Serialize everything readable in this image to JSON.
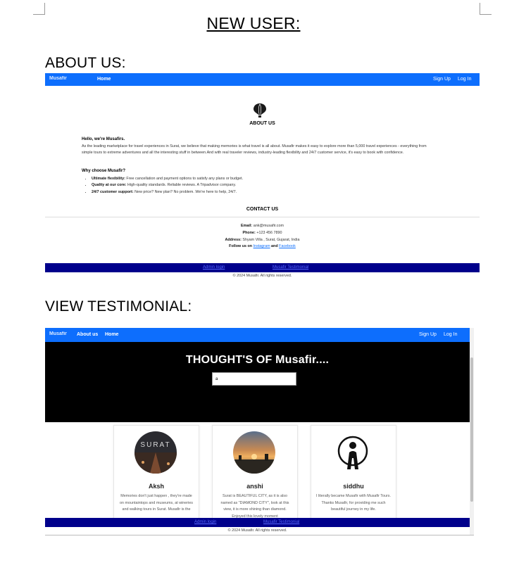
{
  "document": {
    "title": "NEW USER:",
    "sections": {
      "about_heading": "ABOUT US:",
      "testimonial_heading": "VIEW TESTIMONIAL:"
    }
  },
  "about_page": {
    "navbar": {
      "brand": "Musafir",
      "home": "Home",
      "sign_up": "Sign Up",
      "log_in": "Log In"
    },
    "logo_icon": "hot-air-balloon-icon",
    "about_title": "ABOUT US",
    "intro_heading": "Hello, we're Musafirs.",
    "intro_text": "As the leading marketplace for travel experiences in Surat, we believe that making memories is what travel is all about. Musafir makes it easy to explore more than 5,000 travel experiences - everything from simple tours to extreme adventures and all the interesting stuff in between.And with real traveler reviews, industry-leading flexibility and 24/7 customer service, it's easy to book with confidence.",
    "why_heading": "Why choose Musafir?",
    "why_items": [
      {
        "label": "Ultimate flexibility:",
        "text": " Free cancellation and payment options to satisfy any plans or budget."
      },
      {
        "label": "Quality at our core:",
        "text": " High-quality standards. Reliable reviews. A Tripadvisor company."
      },
      {
        "label": "24/7 customer support:",
        "text": " New price? New plan? No problem. We're here to help, 24/7."
      }
    ],
    "contact_title": "CONTACT US",
    "contact": {
      "email_label": "Email:",
      "email": " ank@musafir.com",
      "phone_label": "Phone:",
      "phone": " +123 456 7890",
      "address_label": "Address:",
      "address": " Shyam Villa , Surat, Gujarat, India",
      "follow_label": "Follow us on ",
      "instagram": "Instagram",
      "and": " and ",
      "facebook": "Facebook"
    },
    "footer": {
      "admin_login": "Admin login",
      "musafir_testimonial": "Musafir Testimonial"
    },
    "copyright": "© 2024 Musafir. All rights reserved."
  },
  "testimonial_page": {
    "navbar": {
      "brand": "Musafir",
      "about": "About us",
      "home": "Home",
      "sign_up": "Sign Up",
      "log_in": "Log In"
    },
    "hero_title": "THOUGHT'S OF Musafir....",
    "search_value": "a",
    "cards": [
      {
        "name": "Aksh",
        "avatar_text": "SURAT",
        "text": "Memories don't just happen , they're made on mountaintops and museums, at wineries and walking tours in Surat. Musafir is the"
      },
      {
        "name": "anshi",
        "text": "Surat is BEAUTIFUL CITY, as it is also named as \"DIAMOND CITY\", look at this view, it is more shining than diamond. Enjoyed this lovely moment"
      },
      {
        "name": "siddhu",
        "text": "I literally became Musafir with Musafir Tours. Thanks Musafir, for providing me such beautiful journey in my life."
      }
    ],
    "footer": {
      "admin_login": "Admin login",
      "musafir_testimonial": "Musafir Testimonial"
    },
    "copyright": "© 2024 Musafir. All rights reserved."
  },
  "colors": {
    "navbar": "#0d6efd",
    "footer": "#00008b",
    "hero": "#000000"
  }
}
